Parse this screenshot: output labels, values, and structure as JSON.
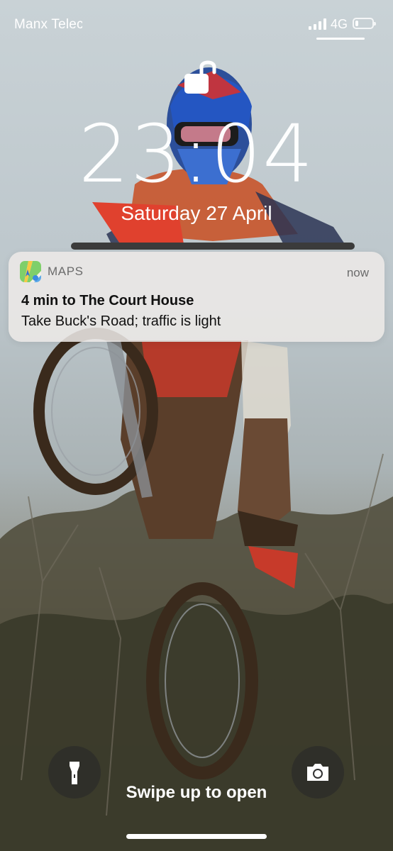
{
  "status_bar": {
    "carrier": "Manx Telecom",
    "network": "4G",
    "signal_bars": 4,
    "battery_level": 0.2
  },
  "lock_screen": {
    "time": "23:04",
    "date": "Saturday 27 April",
    "locked": false
  },
  "notification": {
    "app_icon": "maps-app-icon",
    "app_name": "MAPS",
    "timestamp": "now",
    "title": "4 min to The Court House",
    "body": "Take Buck's Road; traffic is light"
  },
  "bottom": {
    "flashlight_icon": "flashlight-icon",
    "camera_icon": "camera-icon",
    "swipe_hint": "Swipe up to open"
  },
  "colors": {
    "notification_bg": "#eeeae8",
    "button_bg": "#282828",
    "text": "#ffffff"
  }
}
